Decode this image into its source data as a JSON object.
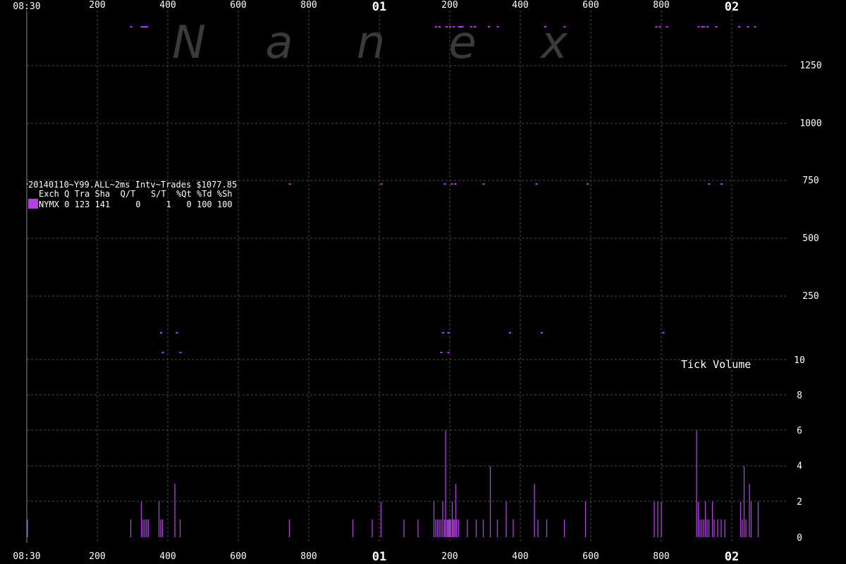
{
  "chart_data": {
    "type": "bar",
    "watermark": [
      "N",
      "a",
      "n",
      "e",
      "x"
    ],
    "x_axis": {
      "start_label": "08:30",
      "ticks": [
        "200",
        "400",
        "600",
        "800",
        "01",
        "200",
        "400",
        "600",
        "800",
        "02"
      ],
      "range_ms": [
        0,
        2200
      ]
    },
    "legend": {
      "title": "20140110~Y99.ALL~2ms Intv~Trades $1077.85",
      "header": "Exch Q Tra Sha  Q/T   S/T  %Qt %Td %Sh",
      "rows": [
        {
          "exch": "NYMX",
          "values": "0 123 141     0     1   0 100 100",
          "color": "#b040e0"
        }
      ]
    },
    "price_panel": {
      "ylabel_ticks": [
        "1250",
        "1000",
        "750",
        "500",
        "250"
      ],
      "series": [
        {
          "name": "NYMX",
          "color": "#b040e0",
          "points_ms": [
            [
              0,
              750
            ],
            [
              295,
              1400
            ],
            [
              325,
              1400
            ],
            [
              330,
              1400
            ],
            [
              335,
              1400
            ],
            [
              340,
              1400
            ],
            [
              380,
              200
            ],
            [
              385,
              130
            ],
            [
              425,
              200
            ],
            [
              435,
              130
            ],
            [
              745,
              750
            ],
            [
              1005,
              750
            ],
            [
              1160,
              1400
            ],
            [
              1170,
              1400
            ],
            [
              1175,
              130
            ],
            [
              1180,
              200
            ],
            [
              1185,
              750
            ],
            [
              1190,
              1400
            ],
            [
              1195,
              200
            ],
            [
              1195,
              130
            ],
            [
              1200,
              1400
            ],
            [
              1205,
              750
            ],
            [
              1210,
              1400
            ],
            [
              1215,
              750
            ],
            [
              1225,
              1400
            ],
            [
              1230,
              1400
            ],
            [
              1235,
              1400
            ],
            [
              1260,
              1400
            ],
            [
              1270,
              1400
            ],
            [
              1295,
              750
            ],
            [
              1310,
              1400
            ],
            [
              1335,
              1400
            ],
            [
              1370,
              200
            ],
            [
              1445,
              750
            ],
            [
              1460,
              200
            ],
            [
              1470,
              1400
            ],
            [
              1525,
              1400
            ],
            [
              1590,
              750
            ],
            [
              1785,
              1400
            ],
            [
              1795,
              1400
            ],
            [
              1805,
              200
            ],
            [
              1815,
              1400
            ],
            [
              1905,
              1400
            ],
            [
              1915,
              1400
            ],
            [
              1920,
              1400
            ],
            [
              1930,
              1400
            ],
            [
              1935,
              750
            ],
            [
              1955,
              1400
            ],
            [
              1970,
              750
            ],
            [
              2020,
              1400
            ],
            [
              2045,
              1400
            ],
            [
              2065,
              1400
            ]
          ]
        }
      ]
    },
    "volume_panel": {
      "title": "Tick Volume",
      "ylabel_ticks": [
        "10",
        "8",
        "6",
        "4",
        "2",
        "0"
      ],
      "ylim": [
        0,
        12
      ],
      "series": [
        {
          "name": "NYMX",
          "color": "#b040e0",
          "bars_ms": [
            [
              2,
              1
            ],
            [
              295,
              1
            ],
            [
              325,
              2
            ],
            [
              330,
              1
            ],
            [
              335,
              1
            ],
            [
              340,
              1
            ],
            [
              345,
              1
            ],
            [
              375,
              2
            ],
            [
              380,
              1
            ],
            [
              385,
              1
            ],
            [
              420,
              3
            ],
            [
              435,
              1
            ],
            [
              745,
              1
            ],
            [
              925,
              1
            ],
            [
              980,
              1
            ],
            [
              1005,
              2
            ],
            [
              1070,
              1
            ],
            [
              1110,
              1
            ],
            [
              1155,
              2
            ],
            [
              1160,
              1
            ],
            [
              1165,
              1
            ],
            [
              1170,
              1
            ],
            [
              1175,
              1
            ],
            [
              1180,
              2
            ],
            [
              1185,
              1
            ],
            [
              1188,
              6
            ],
            [
              1192,
              1
            ],
            [
              1195,
              1
            ],
            [
              1198,
              1
            ],
            [
              1200,
              1
            ],
            [
              1203,
              1
            ],
            [
              1207,
              2
            ],
            [
              1210,
              1
            ],
            [
              1213,
              1
            ],
            [
              1217,
              3
            ],
            [
              1220,
              1
            ],
            [
              1225,
              1
            ],
            [
              1250,
              1
            ],
            [
              1275,
              1
            ],
            [
              1295,
              1
            ],
            [
              1315,
              4
            ],
            [
              1335,
              1
            ],
            [
              1360,
              2
            ],
            [
              1380,
              1
            ],
            [
              1440,
              3
            ],
            [
              1450,
              1
            ],
            [
              1475,
              1
            ],
            [
              1525,
              1
            ],
            [
              1585,
              2
            ],
            [
              1780,
              2
            ],
            [
              1790,
              2
            ],
            [
              1800,
              2
            ],
            [
              1900,
              6
            ],
            [
              1905,
              2
            ],
            [
              1910,
              1
            ],
            [
              1915,
              1
            ],
            [
              1920,
              1
            ],
            [
              1925,
              2
            ],
            [
              1930,
              1
            ],
            [
              1935,
              1
            ],
            [
              1945,
              2
            ],
            [
              1950,
              1
            ],
            [
              1960,
              1
            ],
            [
              1970,
              1
            ],
            [
              1980,
              1
            ],
            [
              2025,
              2
            ],
            [
              2030,
              1
            ],
            [
              2035,
              4
            ],
            [
              2040,
              1
            ],
            [
              2050,
              3
            ],
            [
              2055,
              2
            ],
            [
              2075,
              2
            ]
          ]
        }
      ]
    },
    "grid": true
  }
}
